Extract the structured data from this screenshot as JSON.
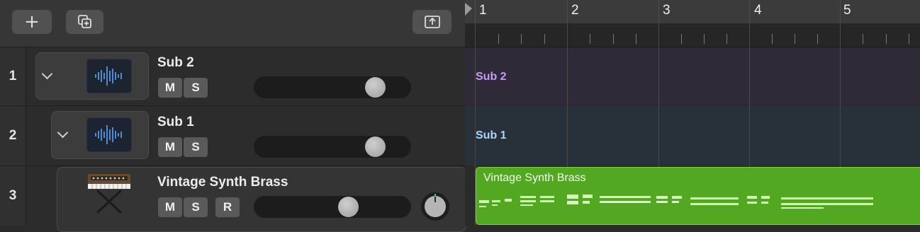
{
  "toolbar": {
    "add_label": "+"
  },
  "tracks": [
    {
      "number": "1",
      "name": "Sub 2",
      "mute": "M",
      "solo": "S",
      "volume": 0.82
    },
    {
      "number": "2",
      "name": "Sub 1",
      "mute": "M",
      "solo": "S",
      "volume": 0.82
    },
    {
      "number": "3",
      "name": "Vintage Synth Brass",
      "mute": "M",
      "solo": "S",
      "record": "R",
      "volume": 0.62
    }
  ],
  "ruler": {
    "bars": [
      "1",
      "2",
      "3",
      "4",
      "5"
    ]
  },
  "lanes": {
    "sub2_label": "Sub 2",
    "sub1_label": "Sub 1"
  },
  "region": {
    "name": "Vintage Synth Brass"
  },
  "colors": {
    "sub2": "#c79cf2",
    "sub1": "#a9d4ff",
    "region": "#52a820"
  }
}
